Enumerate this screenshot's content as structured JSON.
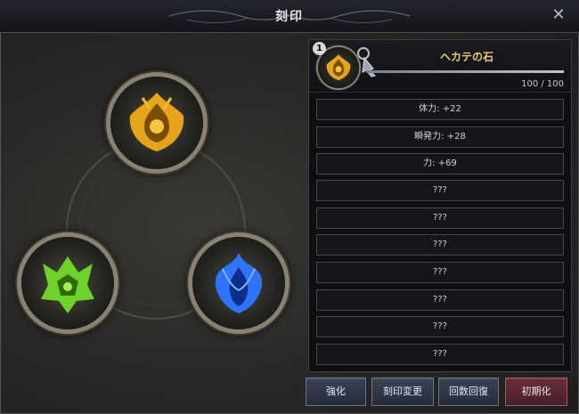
{
  "window": {
    "title": "刻印",
    "close_glyph": "✕"
  },
  "slots": [
    {
      "name": "gold-emblem-icon",
      "color": "#e5a41a"
    },
    {
      "name": "green-emblem-icon",
      "color": "#6fd22a"
    },
    {
      "name": "blue-emblem-icon",
      "color": "#2f74ff"
    }
  ],
  "panel": {
    "badge": "1",
    "stone_name": "ヘカテの石",
    "progress_text": "100 / 100",
    "progress_fraction": 1.0,
    "stats": [
      "体力: +22",
      "瞬発力: +28",
      "力: +69",
      "???",
      "???",
      "???",
      "???",
      "???",
      "???",
      "???"
    ]
  },
  "buttons": {
    "enhance": "強化",
    "change": "刻印変更",
    "restore": "回数回復",
    "reset": "初期化"
  },
  "colors": {
    "accent_gold": "#f2c86a",
    "reset_red": "#6a2e38",
    "button_blue": "#3a4254"
  }
}
